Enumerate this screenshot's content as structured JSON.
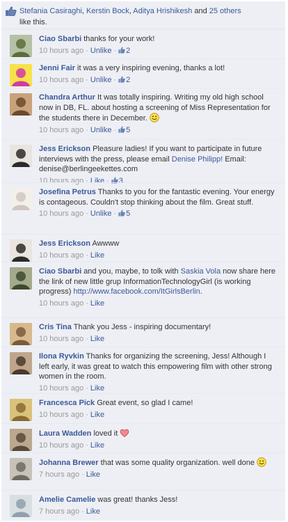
{
  "likes_bar": {
    "names": [
      "Stefania Casiraghi",
      "Kerstin Bock",
      "Aditya Hrishikesh"
    ],
    "and_text": "and",
    "others_link": "25 others",
    "suffix": "like this."
  },
  "comments": [
    {
      "author": "Ciao Sbarbi",
      "text": "thanks for your work!",
      "time": "10 hours ago",
      "action": "Unlike",
      "likes": "2",
      "avatar": "avatar-ciao",
      "avatar_colors": [
        "#5c6d3a",
        "#b6c0a4"
      ]
    },
    {
      "author": "Jenni Fair",
      "text": "it was a very inspiring evening, thanks a lot!",
      "time": "10 hours ago",
      "action": "Unlike",
      "likes": "2",
      "avatar": "avatar-jenni",
      "avatar_colors": [
        "#d23aa0",
        "#f7e24a"
      ]
    },
    {
      "author": "Chandra Arthur",
      "text": "It was totally inspiring. Writing my old high school now in DB, FL. about hosting a screening of Miss Representation for the students there in December.",
      "time": "10 hours ago",
      "action": "Unlike",
      "likes": "5",
      "emoji": "smile",
      "avatar": "avatar-chandra",
      "avatar_colors": [
        "#6b4a2e",
        "#c9a17a"
      ]
    },
    {
      "author": "Jess Erickson",
      "text": "Pleasure ladies! If you want to participate in future interviews with the press, please email",
      "link": "Denise Philipp!",
      "text2": "Email: denise@berlingeekettes.com",
      "time": "10 hours ago",
      "action": "Like",
      "likes": "3",
      "avatar": "avatar-jess",
      "avatar_colors": [
        "#2b2b2b",
        "#e9e4df"
      ]
    },
    {
      "author": "Josefina Petrus",
      "text": "Thanks to you for the fantastic evening. Your energy is contageous. Couldn't stop thinking about the film. Great stuff.",
      "time": "10 hours ago",
      "action": "Unlike",
      "likes": "5",
      "avatar": "avatar-josefina",
      "avatar_colors": [
        "#cfc7bf",
        "#f3efea"
      ]
    },
    {
      "author": "Jess Erickson",
      "text": "Awwww",
      "time": "10 hours ago",
      "action": "Like",
      "avatar": "avatar-jess2",
      "avatar_colors": [
        "#2b2b2b",
        "#e9e4df"
      ]
    },
    {
      "author": "Ciao Sbarbi",
      "text": "and you, maybe, to tolk with",
      "link": "Saskia Vola",
      "text2": "now share here the link of new little grup InformationTechnologyGirl (is working progress)",
      "url": "http://www.facebook.com/ItGirlsBerlin",
      "url_suffix": ".",
      "time": "10 hours ago",
      "action": "Like",
      "avatar": "avatar-ciao2",
      "avatar_colors": [
        "#3e4a30",
        "#a3a98a"
      ]
    },
    {
      "author": "Cris Tina",
      "text": "Thank you Jess - inspiring documentary!",
      "time": "10 hours ago",
      "action": "Like",
      "avatar": "avatar-cris",
      "avatar_colors": [
        "#7a5a3c",
        "#d7b98e"
      ]
    },
    {
      "author": "Ilona Ryvkin",
      "text": "Thanks for organizing the screening, Jess! Although I left early, it was great to watch this empowering film with other strong women in the room.",
      "time": "10 hours ago",
      "action": "Like",
      "avatar": "avatar-ilona",
      "avatar_colors": [
        "#4a3a2d",
        "#bfa58c"
      ]
    },
    {
      "author": "Francesca Pick",
      "text": "Great event, so glad I came!",
      "time": "10 hours ago",
      "action": "Like",
      "avatar": "avatar-francesca",
      "avatar_colors": [
        "#8a6a32",
        "#d9c27a"
      ]
    },
    {
      "author": "Laura Wadden",
      "text": "loved it",
      "emoji": "heart",
      "time": "10 hours ago",
      "action": "Like",
      "avatar": "avatar-laura",
      "avatar_colors": [
        "#5b4a3b",
        "#bca88f"
      ]
    },
    {
      "author": "Johanna Brewer",
      "text": "that was some quality organization. well done",
      "emoji": "smile",
      "time": "7 hours ago",
      "action": "Like",
      "avatar": "avatar-johanna",
      "avatar_colors": [
        "#6e6a62",
        "#c7c2b8"
      ]
    },
    {
      "author": "Amelie Camelie",
      "text": "was great! thanks Jess!",
      "time": "7 hours ago",
      "action": "Like",
      "avatar": "avatar-amelie",
      "avatar_colors": [
        "#8fa1ad",
        "#d8dfe2"
      ]
    }
  ],
  "colors": {
    "link": "#3b5998",
    "meta": "#999999",
    "background": "#edeff4"
  }
}
